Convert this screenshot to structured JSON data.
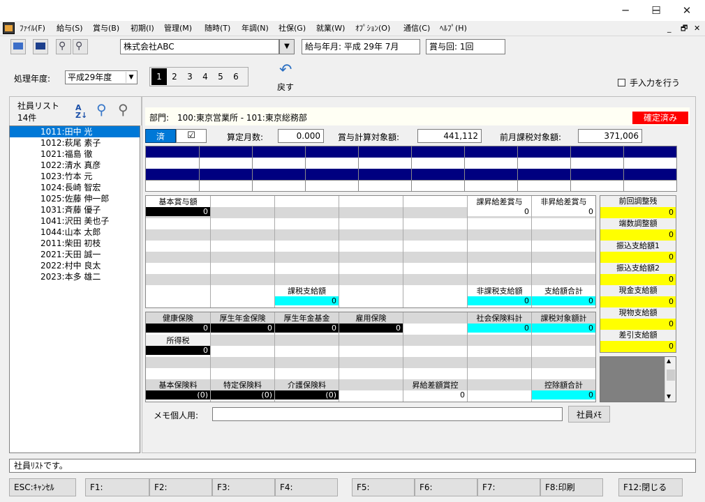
{
  "colors": {
    "navy": "#000080",
    "cyan": "#00ffff",
    "yellow": "#ffff00",
    "red": "#ff0000",
    "gray": "#808080",
    "selection": "#0078d7"
  },
  "window": {
    "minimize": "─",
    "maximize": "☐",
    "close": "✕",
    "mdi_min": "_",
    "mdi_restore": "🗗",
    "mdi_close": "✕"
  },
  "menu": [
    "ﾌｧｲﾙ(F)",
    "給与(S)",
    "賞与(B)",
    "初期(I)",
    "管理(M)",
    "随時(T)",
    "年調(N)",
    "社保(G)",
    "就業(W)",
    "ｵﾌﾟｼｮﾝ(O)",
    "通信(C)",
    "ﾍﾙﾌﾟ(H)"
  ],
  "toolbar": {
    "company": "株式会社ABC",
    "pay_month_label": "給与年月:",
    "pay_month": "平成 29年  7月",
    "bonus_label": "賞与回:",
    "bonus_value": "1回"
  },
  "year": {
    "label": "処理年度:",
    "value": "平成29年度"
  },
  "pages": [
    "1",
    "2",
    "3",
    "4",
    "5",
    "6"
  ],
  "back": {
    "label": "戻す"
  },
  "manual": {
    "label": "手入力を行う"
  },
  "list": {
    "title": "社員リスト",
    "count": "14件",
    "items": [
      "1011:田中  光",
      "1012:萩尾  素子",
      "1021:福島  徹",
      "1022:清水  真彦",
      "1023:竹本  元",
      "1024:長崎  智宏",
      "1025:佐藤  伸一郎",
      "1031:斉藤  優子",
      "1041:沢田  美也子",
      "1044:山本  太郎",
      "2011:柴田  初枝",
      "2021:天田  誠一",
      "2022:村中  良太",
      "2023:本多  雄二"
    ]
  },
  "dept": {
    "label": "部門:",
    "value": "100:東京営業所 - 101:東京総務部",
    "status": "確定済み"
  },
  "calc": {
    "done_label": "済",
    "check": "☑",
    "months_label": "算定月数:",
    "months": "0.000",
    "target_label": "賞与計算対象額:",
    "target": "441,112",
    "prev_label": "前月課税対象額:",
    "prev": "371,006"
  },
  "pay": {
    "base_label": "基本賞与額",
    "base": "0",
    "diff_tax_label": "課昇給差賞与",
    "diff_tax": "0",
    "diff_non_label": "非昇給差賞与",
    "diff_non": "0",
    "taxable_label": "課税支給額",
    "taxable": "0",
    "non_taxable_label": "非課税支給額",
    "non_taxable": "0",
    "total_label": "支給額合計",
    "total": "0"
  },
  "ded": {
    "health_label": "健康保険",
    "health": "0",
    "pension_label": "厚生年金保険",
    "pension": "0",
    "fund_label": "厚生年金基金",
    "fund": "0",
    "employ_label": "雇用保険",
    "employ": "0",
    "social_label": "社会保険料計",
    "social": "0",
    "taxable_label": "課税対象額計",
    "taxable": "0",
    "income_label": "所得税",
    "income": "0",
    "basic_label": "基本保険料",
    "basic": "(0)",
    "special_label": "特定保険料",
    "special": "(0)",
    "care_label": "介護保険料",
    "care": "(0)",
    "raise_label": "昇給差額賞控",
    "raise": "0",
    "total_label": "控除額合計",
    "total": "0"
  },
  "side": [
    {
      "label": "前回調整残",
      "value": "0"
    },
    {
      "label": "端数調整額",
      "value": "0"
    },
    {
      "label": "振込支給額1",
      "value": "0"
    },
    {
      "label": "振込支給額2",
      "value": "0"
    },
    {
      "label": "現金支給額",
      "value": "0"
    },
    {
      "label": "現物支給額",
      "value": "0"
    },
    {
      "label": "差引支給額",
      "value": "0"
    }
  ],
  "memo": {
    "label": "メモ個人用:",
    "button": "社員ﾒﾓ"
  },
  "status": "社員ﾘｽﾄです。",
  "fkeys": [
    "ESC:ｷｬﾝｾﾙ",
    "F1:",
    "F2:",
    "F3:",
    "F4:",
    "F5:",
    "F6:",
    "F7:",
    "F8:印刷",
    "F12:閉じる"
  ]
}
